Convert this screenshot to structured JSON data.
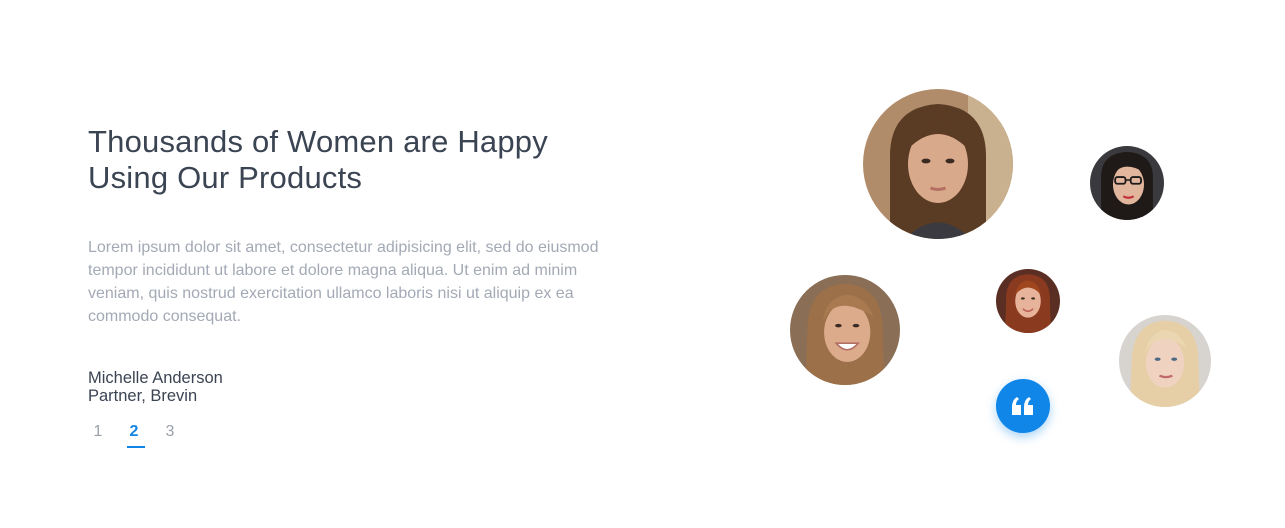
{
  "testimonial": {
    "heading_line1": "Thousands of Women are Happy",
    "heading_line2": "Using Our Products",
    "body": "Lorem ipsum dolor sit amet, consectetur adipisicing elit, sed do eiusmod tempor incididunt ut labore et dolore magna aliqua. Ut enim ad minim veniam, quis nostrud exercitation ullamco laboris nisi ut aliquip ex ea commodo consequat.",
    "author_name": "Michelle Anderson",
    "author_role": "Partner, Brevin"
  },
  "pagination": {
    "pages": [
      "1",
      "2",
      "3"
    ],
    "active": "2"
  },
  "avatars": [
    {
      "id": "avatar-brunette-portrait",
      "hair": "#5a3b24",
      "skin": "#d9a98b",
      "bg": "#b08c6a"
    },
    {
      "id": "avatar-glasses-woman",
      "hair": "#1f1a18",
      "skin": "#e2b59d",
      "bg": "#3a3a3e"
    },
    {
      "id": "avatar-smiling-blonde",
      "hair": "#9c7048",
      "skin": "#dcab8c",
      "bg": "#8a6e55"
    },
    {
      "id": "avatar-redhead",
      "hair": "#8a3b1f",
      "skin": "#e7b39a",
      "bg": "#5a2e22"
    },
    {
      "id": "avatar-light-blonde",
      "hair": "#e6cfa6",
      "skin": "#f0d2c0",
      "bg": "#d7d3cf"
    }
  ],
  "quote_icon": "quote-icon",
  "colors": {
    "accent": "#1185e6",
    "heading": "#3b4452",
    "body": "#a3a9b5"
  }
}
